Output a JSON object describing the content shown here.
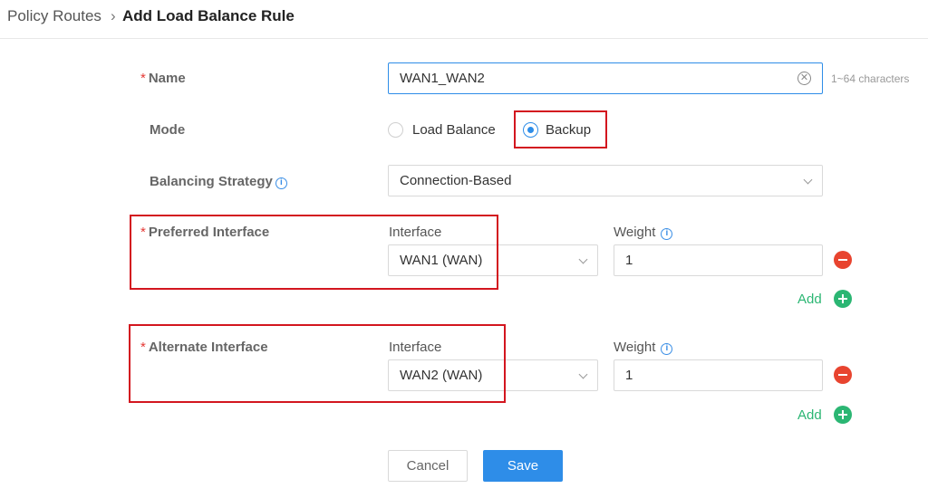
{
  "breadcrumb": {
    "parent": "Policy Routes",
    "separator": "›",
    "current": "Add Load Balance Rule"
  },
  "form": {
    "name": {
      "required_mark": "*",
      "label": "Name",
      "value": "WAN1_WAN2",
      "hint": "1~64 characters"
    },
    "mode": {
      "label": "Mode",
      "options": [
        "Load Balance",
        "Backup"
      ],
      "selected": "Backup"
    },
    "balancing_strategy": {
      "label": "Balancing Strategy",
      "value": "Connection-Based"
    },
    "preferred": {
      "required_mark": "*",
      "label": "Preferred Interface",
      "interface_header": "Interface",
      "weight_header": "Weight",
      "interface_value": "WAN1 (WAN)",
      "weight_value": "1",
      "add_label": "Add"
    },
    "alternate": {
      "required_mark": "*",
      "label": "Alternate Interface",
      "interface_header": "Interface",
      "weight_header": "Weight",
      "interface_value": "WAN2 (WAN)",
      "weight_value": "1",
      "add_label": "Add"
    }
  },
  "buttons": {
    "cancel": "Cancel",
    "save": "Save"
  },
  "icons": {
    "info": "info-circle-icon",
    "clear": "clear-circle-icon",
    "dropdown": "chevron-down-icon",
    "remove": "minus-circle-icon",
    "add": "plus-circle-icon"
  },
  "colors": {
    "primary": "#2e8de8",
    "danger": "#e8442f",
    "success": "#2bb673",
    "annotation": "#d3161f"
  }
}
